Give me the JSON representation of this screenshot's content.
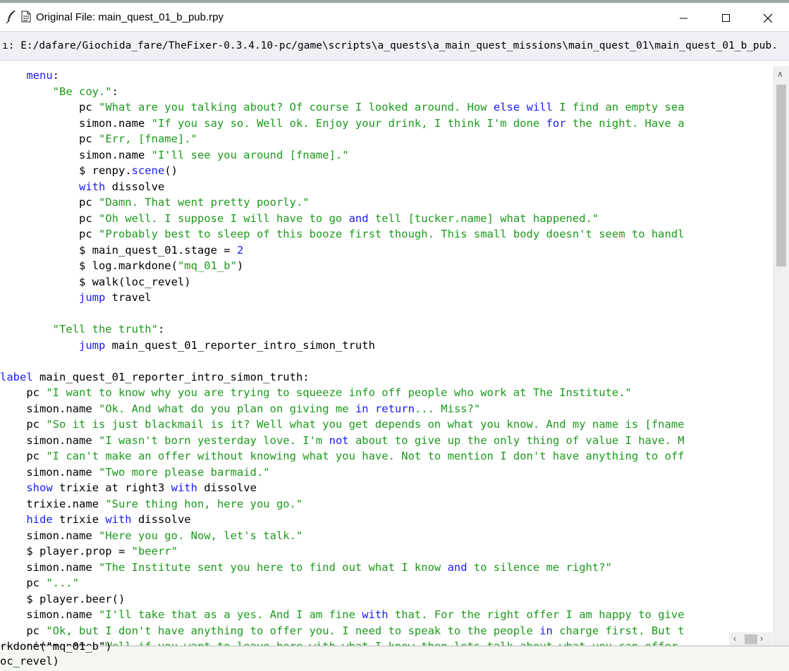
{
  "window": {
    "title": "Original File: main_quest_01_b_pub.rpy",
    "path": "ı: E:/dafare/Giochida_fare/TheFixer-0.3.4.10-pc/game\\scripts\\a_quests\\a_main_quest_missions\\main_quest_01\\main_quest_01_b_pub."
  },
  "icons": [
    "feather-icon",
    "document-icon",
    "minimize-icon",
    "maximize-icon",
    "close-icon"
  ],
  "colors": {
    "keyword": "#1a1aff",
    "string": "#1b9a1b",
    "text": "#000000"
  },
  "code": [
    [
      {
        "t": "    "
      },
      {
        "t": "menu",
        "k": "kw"
      },
      {
        "t": ":"
      }
    ],
    [
      {
        "t": "        "
      },
      {
        "t": "\"Be coy.\"",
        "k": "str"
      },
      {
        "t": ":"
      }
    ],
    [
      {
        "t": "            pc "
      },
      {
        "t": "\"What are you talking about? Of course I looked around. How ",
        "k": "str"
      },
      {
        "t": "else",
        "k": "kw"
      },
      {
        "t": " ",
        "k": "str"
      },
      {
        "t": "will",
        "k": "kw"
      },
      {
        "t": " I find an empty sea",
        "k": "str"
      }
    ],
    [
      {
        "t": "            simon.name "
      },
      {
        "t": "\"If you say so. Well ok. Enjoy your drink, I think I'm done ",
        "k": "str"
      },
      {
        "t": "for",
        "k": "kw"
      },
      {
        "t": " the night. Have a",
        "k": "str"
      }
    ],
    [
      {
        "t": "            pc "
      },
      {
        "t": "\"Err, [fname].\"",
        "k": "str"
      }
    ],
    [
      {
        "t": "            simon.name "
      },
      {
        "t": "\"I'll see you around [fname].\"",
        "k": "str"
      }
    ],
    [
      {
        "t": "            $ renpy."
      },
      {
        "t": "scene",
        "k": "kw"
      },
      {
        "t": "()"
      }
    ],
    [
      {
        "t": "            "
      },
      {
        "t": "with",
        "k": "kw"
      },
      {
        "t": " dissolve"
      }
    ],
    [
      {
        "t": "            pc "
      },
      {
        "t": "\"Damn. That went pretty poorly.\"",
        "k": "str"
      }
    ],
    [
      {
        "t": "            pc "
      },
      {
        "t": "\"Oh well. I suppose I will have to go ",
        "k": "str"
      },
      {
        "t": "and",
        "k": "kw"
      },
      {
        "t": " tell [tucker.name] what happened.\"",
        "k": "str"
      }
    ],
    [
      {
        "t": "            pc "
      },
      {
        "t": "\"Probably best to sleep of this booze first though. This small body doesn't seem to handl",
        "k": "str"
      }
    ],
    [
      {
        "t": "            $ main_quest_01.stage = "
      },
      {
        "t": "2",
        "k": "num"
      }
    ],
    [
      {
        "t": "            $ log.markdone("
      },
      {
        "t": "\"mq_01_b\"",
        "k": "str"
      },
      {
        "t": ")"
      }
    ],
    [
      {
        "t": "            $ walk(loc_revel)"
      }
    ],
    [
      {
        "t": "            "
      },
      {
        "t": "jump",
        "k": "kw"
      },
      {
        "t": " travel"
      }
    ],
    [
      {
        "t": ""
      }
    ],
    [
      {
        "t": "        "
      },
      {
        "t": "\"Tell the truth\"",
        "k": "str"
      },
      {
        "t": ":"
      }
    ],
    [
      {
        "t": "            "
      },
      {
        "t": "jump",
        "k": "kw"
      },
      {
        "t": " main_quest_01_reporter_intro_simon_truth"
      }
    ],
    [
      {
        "t": ""
      }
    ],
    [
      {
        "t": "label",
        "k": "kw"
      },
      {
        "t": " main_quest_01_reporter_intro_simon_truth:"
      }
    ],
    [
      {
        "t": "    pc "
      },
      {
        "t": "\"I want to know why you are trying to squeeze info off people who work at The Institute.\"",
        "k": "str"
      }
    ],
    [
      {
        "t": "    simon.name "
      },
      {
        "t": "\"Ok. And what do you plan on giving me ",
        "k": "str"
      },
      {
        "t": "in",
        "k": "kw"
      },
      {
        "t": " ",
        "k": "str"
      },
      {
        "t": "return",
        "k": "kw"
      },
      {
        "t": "... Miss?\"",
        "k": "str"
      }
    ],
    [
      {
        "t": "    pc "
      },
      {
        "t": "\"So it is just blackmail is it? Well what you get depends on what you know. And my name is [fname",
        "k": "str"
      }
    ],
    [
      {
        "t": "    simon.name "
      },
      {
        "t": "\"I wasn't born yesterday love. I'm ",
        "k": "str"
      },
      {
        "t": "not",
        "k": "kw"
      },
      {
        "t": " about to give up the only thing of value I have. M",
        "k": "str"
      }
    ],
    [
      {
        "t": "    pc "
      },
      {
        "t": "\"I can't make an offer without knowing what you have. Not to mention I don't have anything to off",
        "k": "str"
      }
    ],
    [
      {
        "t": "    simon.name "
      },
      {
        "t": "\"Two more please barmaid.\"",
        "k": "str"
      }
    ],
    [
      {
        "t": "    "
      },
      {
        "t": "show",
        "k": "kw"
      },
      {
        "t": " trixie at right3 "
      },
      {
        "t": "with",
        "k": "kw"
      },
      {
        "t": " dissolve"
      }
    ],
    [
      {
        "t": "    trixie.name "
      },
      {
        "t": "\"Sure thing hon, here you go.\"",
        "k": "str"
      }
    ],
    [
      {
        "t": "    "
      },
      {
        "t": "hide",
        "k": "kw"
      },
      {
        "t": " trixie "
      },
      {
        "t": "with",
        "k": "kw"
      },
      {
        "t": " dissolve"
      }
    ],
    [
      {
        "t": "    simon.name "
      },
      {
        "t": "\"Here you go. Now, let's talk.\"",
        "k": "str"
      }
    ],
    [
      {
        "t": "    $ player.prop = "
      },
      {
        "t": "\"beerr\"",
        "k": "str"
      }
    ],
    [
      {
        "t": "    simon.name "
      },
      {
        "t": "\"The Institute sent you here to find out what I know ",
        "k": "str"
      },
      {
        "t": "and",
        "k": "kw"
      },
      {
        "t": " to silence me right?\"",
        "k": "str"
      }
    ],
    [
      {
        "t": "    pc "
      },
      {
        "t": "\"...\"",
        "k": "str"
      }
    ],
    [
      {
        "t": "    $ player.beer()"
      }
    ],
    [
      {
        "t": "    simon.name "
      },
      {
        "t": "\"I'll take that as a yes. And I am fine ",
        "k": "str"
      },
      {
        "t": "with",
        "k": "kw"
      },
      {
        "t": " that. For the right offer I am happy to give",
        "k": "str"
      }
    ],
    [
      {
        "t": "    pc "
      },
      {
        "t": "\"Ok, but I don't have anything to offer you. I need to speak to the people ",
        "k": "str"
      },
      {
        "t": "in",
        "k": "kw"
      },
      {
        "t": " charge first. But t",
        "k": "str"
      }
    ],
    [
      {
        "t": "    simon.name "
      },
      {
        "t": "\"Well if you want to leave here with what I know then lets talk about what you can offer",
        "k": "str"
      }
    ]
  ],
  "background": {
    "lines": [
      "rkdone(\"mq_01_b\")",
      "oc_revel)"
    ]
  }
}
